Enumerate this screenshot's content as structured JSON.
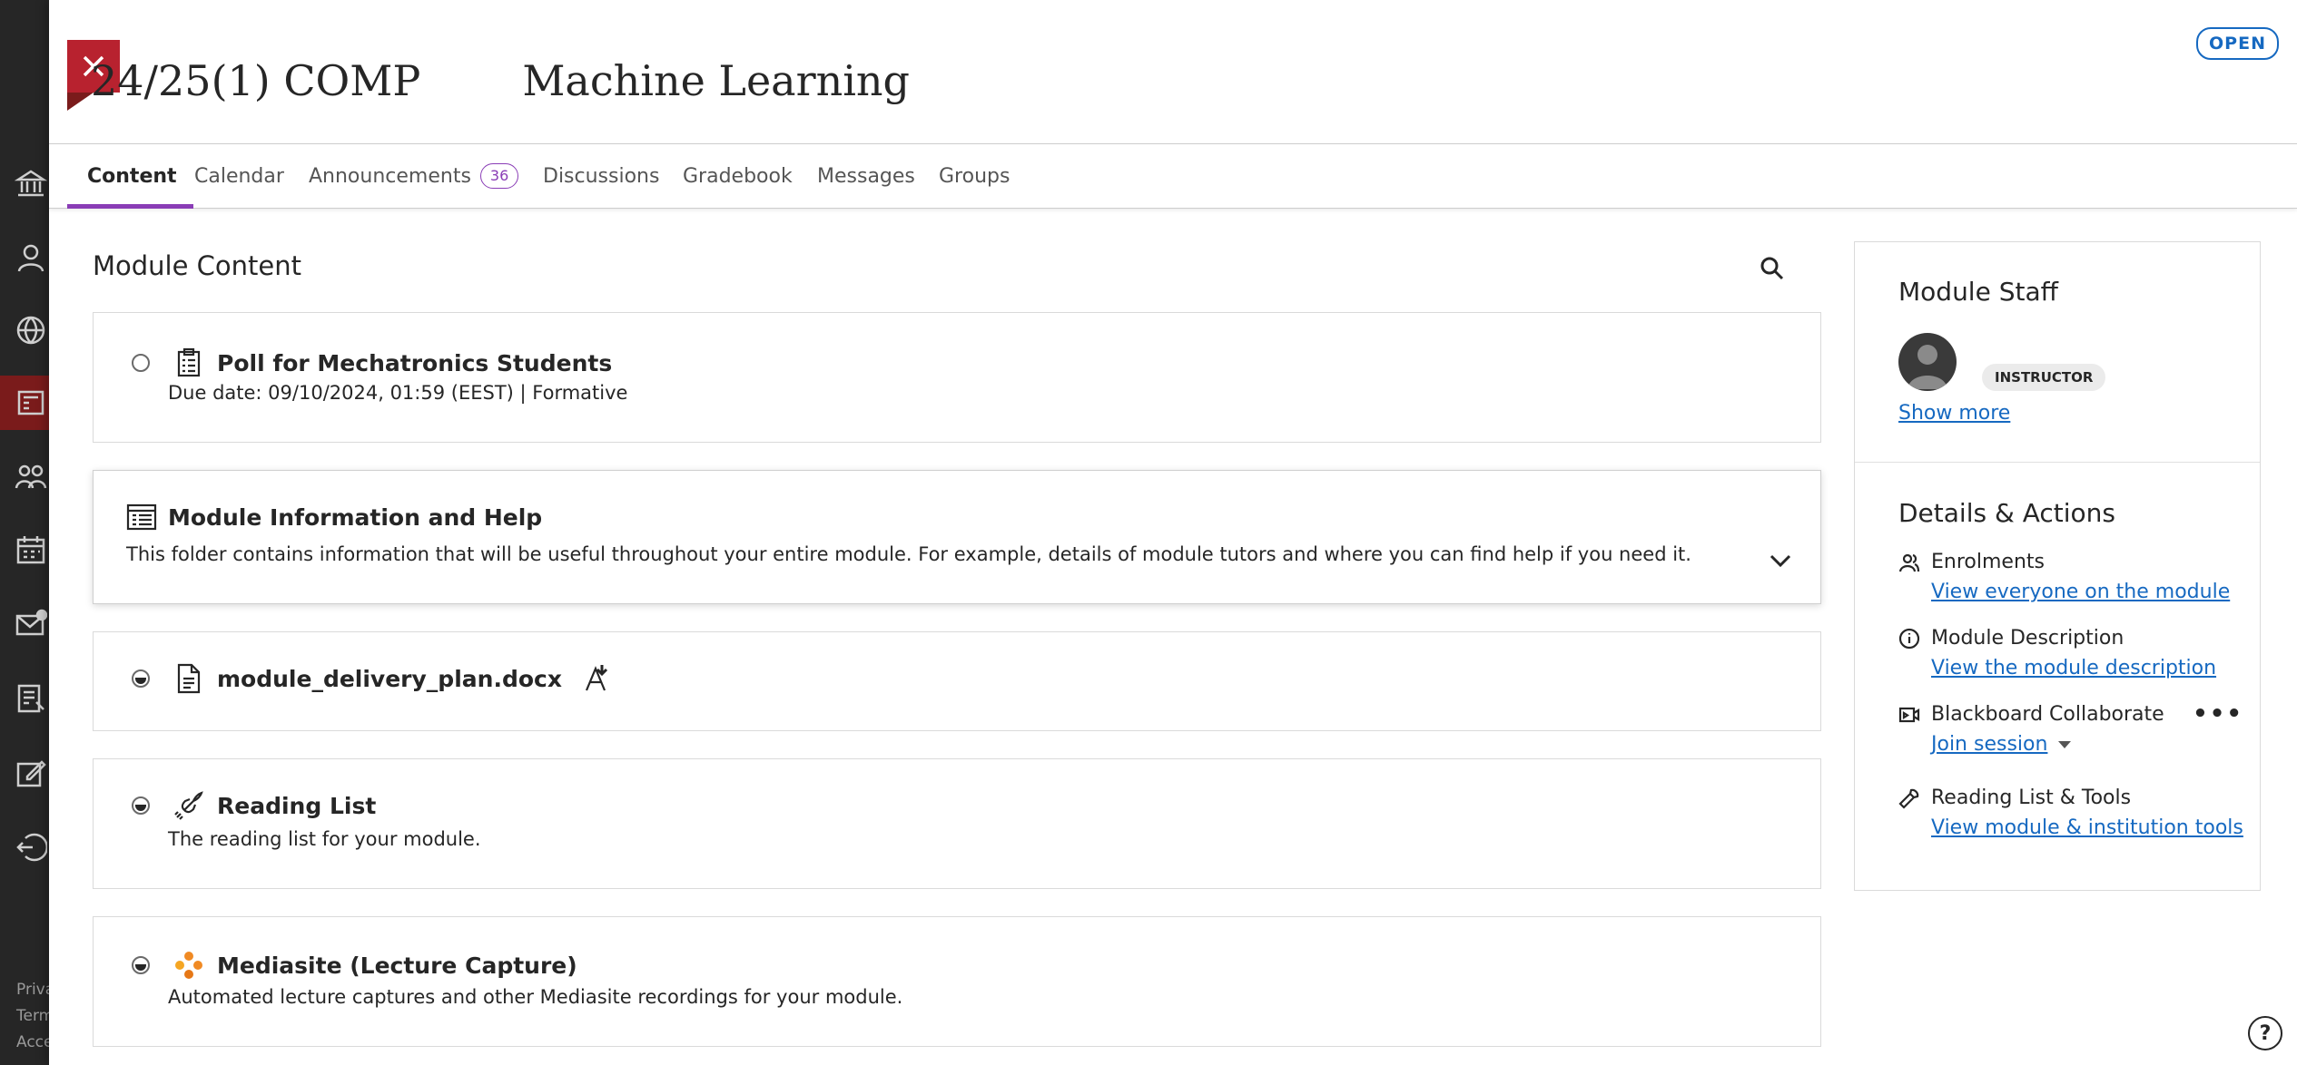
{
  "rail": {
    "items": [
      "institution-icon",
      "profile-icon",
      "globe-icon",
      "courses-icon",
      "groups-icon",
      "calendar-icon",
      "messages-icon",
      "grades-icon",
      "edit-icon",
      "sign-out-icon"
    ],
    "footer": [
      "Priva",
      "Term",
      "Acce"
    ]
  },
  "header": {
    "close_label": "Close",
    "status": "OPEN",
    "course_code": "24/25(1) COMP",
    "course_name": "Machine Learning"
  },
  "tabs": [
    {
      "label": "Content",
      "active": true
    },
    {
      "label": "Calendar"
    },
    {
      "label": "Announcements",
      "count": "36"
    },
    {
      "label": "Discussions"
    },
    {
      "label": "Gradebook"
    },
    {
      "label": "Messages"
    },
    {
      "label": "Groups"
    }
  ],
  "content": {
    "title": "Module Content",
    "items": [
      {
        "title": "Poll for Mechatronics Students",
        "meta": "Due date: 09/10/2024, 01:59 (EEST)  |  Formative",
        "icon": "clipboard-icon"
      },
      {
        "title": "Module Information and Help",
        "description": "This folder contains information that will be useful throughout your entire module. For example, details of module tutors and where you can find help if you need it.",
        "icon": "folder-list-icon"
      },
      {
        "title": "module_delivery_plan.docx",
        "icon": "document-icon"
      },
      {
        "title": "Reading List",
        "description": "The reading list for your module.",
        "icon": "rocket-icon"
      },
      {
        "title": "Mediasite (Lecture Capture)",
        "description": "Automated lecture captures and other Mediasite recordings for your module.",
        "icon": "mediasite-icon"
      }
    ]
  },
  "sidebar": {
    "staff_title": "Module Staff",
    "role": "INSTRUCTOR",
    "show_more": "Show more",
    "details_title": "Details & Actions",
    "details": [
      {
        "title": "Enrolments",
        "link": "View everyone on the module"
      },
      {
        "title": "Module Description",
        "link": "View the module description"
      },
      {
        "title": "Blackboard Collaborate",
        "link": "Join session",
        "more": "•••"
      },
      {
        "title": "Reading List & Tools",
        "link": "View module & institution tools"
      }
    ]
  },
  "help": "?",
  "colors": {
    "accent": "#8a3db6",
    "close": "#b8222f",
    "link": "#1669c1",
    "rail": "#262626"
  }
}
